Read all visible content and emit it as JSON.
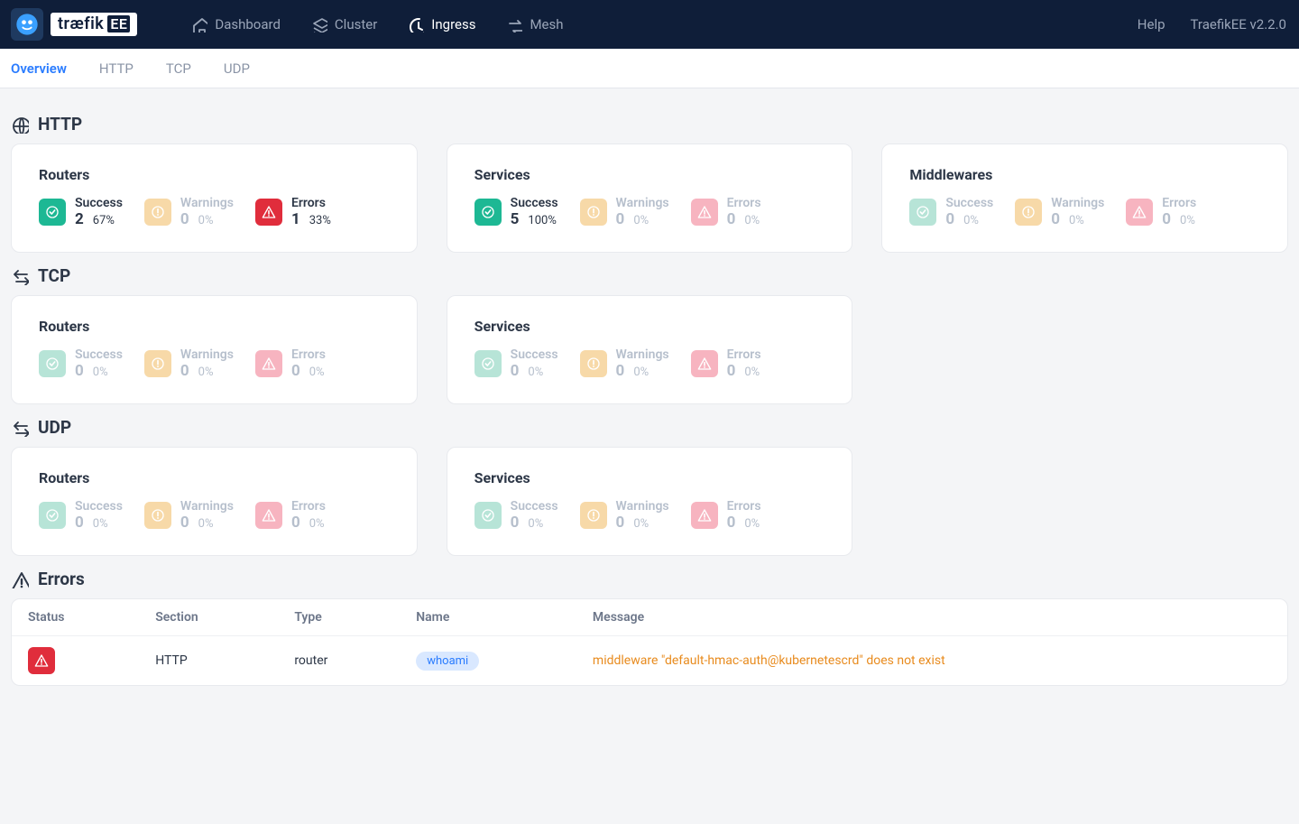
{
  "brand": {
    "name": "træfik",
    "suffix": "EE"
  },
  "nav": {
    "items": [
      {
        "label": "Dashboard",
        "name": "dashboard"
      },
      {
        "label": "Cluster",
        "name": "cluster"
      },
      {
        "label": "Ingress",
        "name": "ingress"
      },
      {
        "label": "Mesh",
        "name": "mesh"
      }
    ],
    "active": "ingress",
    "help": "Help",
    "version": "TraefikEE  v2.2.0"
  },
  "subnav": {
    "tabs": [
      "Overview",
      "HTTP",
      "TCP",
      "UDP"
    ],
    "active": "Overview"
  },
  "labels": {
    "success": "Success",
    "warnings": "Warnings",
    "errors": "Errors",
    "routers": "Routers",
    "services": "Services",
    "middlewares": "Middlewares"
  },
  "sections": [
    {
      "title": "HTTP",
      "icon": "globe",
      "cards": [
        {
          "title": "Routers",
          "success": {
            "count": "2",
            "pct": "67%",
            "active": true
          },
          "warnings": {
            "count": "0",
            "pct": "0%",
            "active": false
          },
          "errors": {
            "count": "1",
            "pct": "33%",
            "active": true
          }
        },
        {
          "title": "Services",
          "success": {
            "count": "5",
            "pct": "100%",
            "active": true
          },
          "warnings": {
            "count": "0",
            "pct": "0%",
            "active": false
          },
          "errors": {
            "count": "0",
            "pct": "0%",
            "active": false
          }
        },
        {
          "title": "Middlewares",
          "success": {
            "count": "0",
            "pct": "0%",
            "active": false
          },
          "warnings": {
            "count": "0",
            "pct": "0%",
            "active": false
          },
          "errors": {
            "count": "0",
            "pct": "0%",
            "active": false
          }
        }
      ]
    },
    {
      "title": "TCP",
      "icon": "swap",
      "cards": [
        {
          "title": "Routers",
          "success": {
            "count": "0",
            "pct": "0%",
            "active": false
          },
          "warnings": {
            "count": "0",
            "pct": "0%",
            "active": false
          },
          "errors": {
            "count": "0",
            "pct": "0%",
            "active": false
          }
        },
        {
          "title": "Services",
          "success": {
            "count": "0",
            "pct": "0%",
            "active": false
          },
          "warnings": {
            "count": "0",
            "pct": "0%",
            "active": false
          },
          "errors": {
            "count": "0",
            "pct": "0%",
            "active": false
          }
        },
        {
          "phantom": true
        }
      ]
    },
    {
      "title": "UDP",
      "icon": "swap",
      "cards": [
        {
          "title": "Routers",
          "success": {
            "count": "0",
            "pct": "0%",
            "active": false
          },
          "warnings": {
            "count": "0",
            "pct": "0%",
            "active": false
          },
          "errors": {
            "count": "0",
            "pct": "0%",
            "active": false
          }
        },
        {
          "title": "Services",
          "success": {
            "count": "0",
            "pct": "0%",
            "active": false
          },
          "warnings": {
            "count": "0",
            "pct": "0%",
            "active": false
          },
          "errors": {
            "count": "0",
            "pct": "0%",
            "active": false
          }
        },
        {
          "phantom": true
        }
      ]
    }
  ],
  "errors": {
    "title": "Errors",
    "columns": [
      "Status",
      "Section",
      "Type",
      "Name",
      "Message"
    ],
    "rows": [
      {
        "status": "error",
        "section": "HTTP",
        "type": "router",
        "name": "whoami",
        "message": "middleware \"default-hmac-auth@kubernetescrd\" does not exist"
      }
    ]
  }
}
